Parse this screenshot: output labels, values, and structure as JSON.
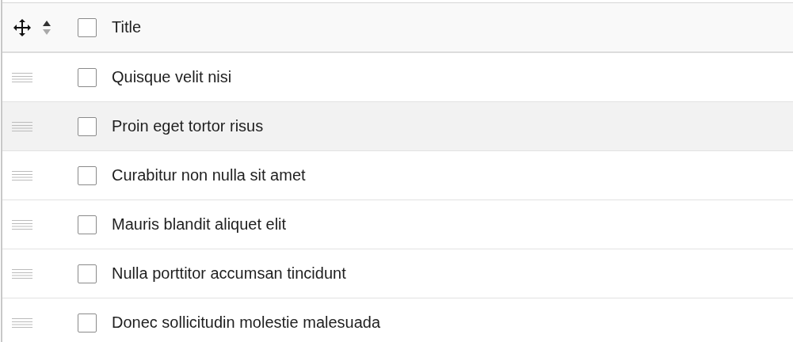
{
  "table": {
    "header": {
      "title": "Title",
      "checked": false
    },
    "rows": [
      {
        "title": "Quisque velit nisi",
        "checked": false,
        "highlighted": false
      },
      {
        "title": "Proin eget tortor risus",
        "checked": false,
        "highlighted": true
      },
      {
        "title": "Curabitur non nulla sit amet",
        "checked": false,
        "highlighted": false
      },
      {
        "title": "Mauris blandit aliquet elit",
        "checked": false,
        "highlighted": false
      },
      {
        "title": "Nulla porttitor accumsan tincidunt",
        "checked": false,
        "highlighted": false
      },
      {
        "title": "Donec sollicitudin molestie malesuada",
        "checked": false,
        "highlighted": false
      }
    ]
  }
}
